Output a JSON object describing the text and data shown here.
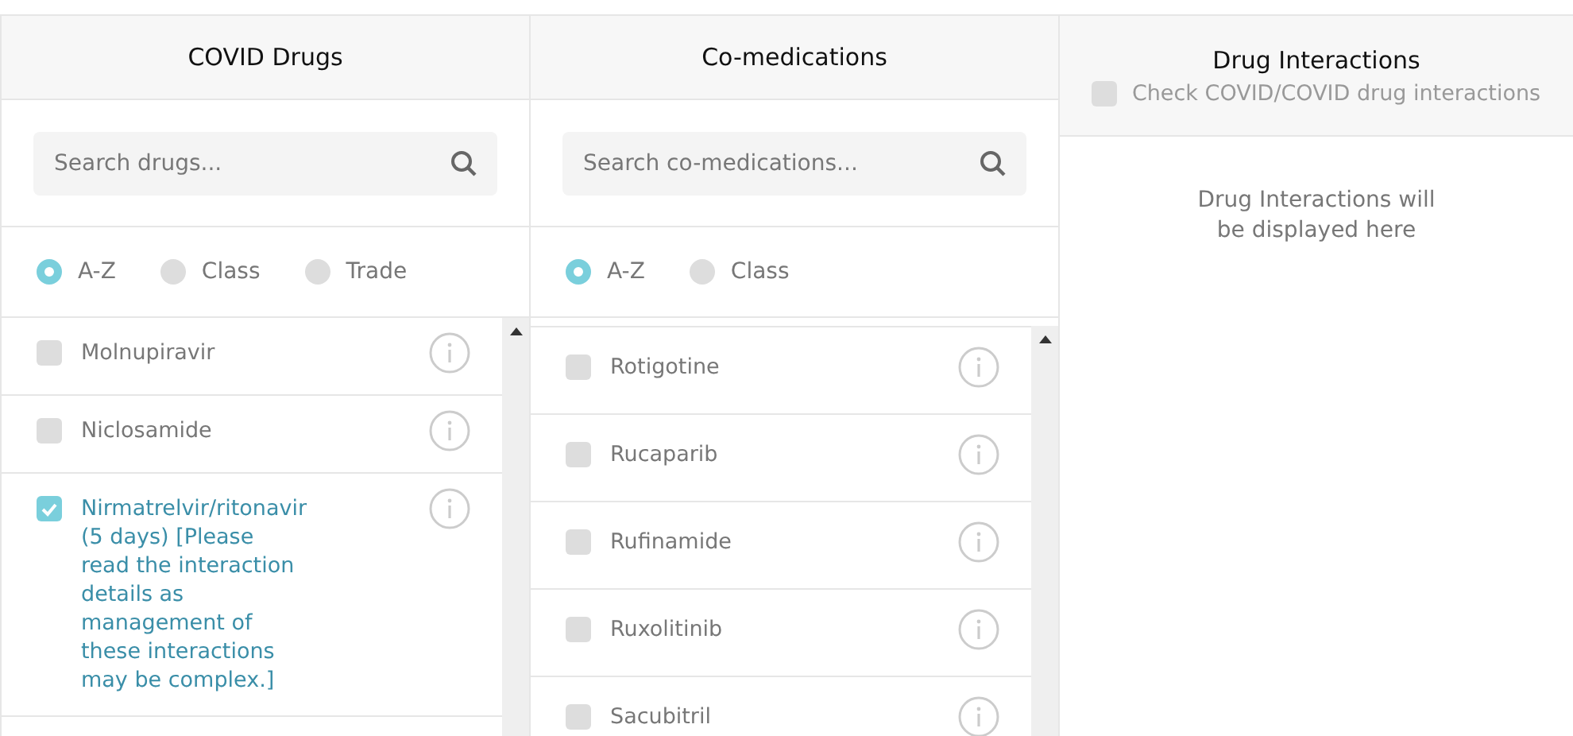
{
  "columns": [
    {
      "title": "COVID Drugs",
      "search": {
        "placeholder": "Search drugs..."
      },
      "sort_options": [
        {
          "label": "A-Z",
          "selected": true
        },
        {
          "label": "Class",
          "selected": false
        },
        {
          "label": "Trade",
          "selected": false
        }
      ],
      "items": [
        {
          "name": "Molnupiravir",
          "checked": false
        },
        {
          "name": "Niclosamide",
          "checked": false
        },
        {
          "name": "Nirmatrelvir/ritonavir (5 days) [Please read the interaction details as management of these interactions may be complex.]",
          "checked": true
        }
      ]
    },
    {
      "title": "Co-medications",
      "search": {
        "placeholder": "Search co-medications..."
      },
      "sort_options": [
        {
          "label": "A-Z",
          "selected": true
        },
        {
          "label": "Class",
          "selected": false
        }
      ],
      "items": [
        {
          "name": "Rotigotine",
          "checked": false
        },
        {
          "name": "Rucaparib",
          "checked": false
        },
        {
          "name": "Rufinamide",
          "checked": false
        },
        {
          "name": "Ruxolitinib",
          "checked": false
        },
        {
          "name": "Sacubitril",
          "checked": false
        }
      ]
    }
  ],
  "interactions": {
    "title": "Drug Interactions",
    "covid_check": {
      "label": "Check COVID/COVID drug interactions",
      "checked": false
    },
    "message": "Drug Interactions will be displayed here"
  }
}
